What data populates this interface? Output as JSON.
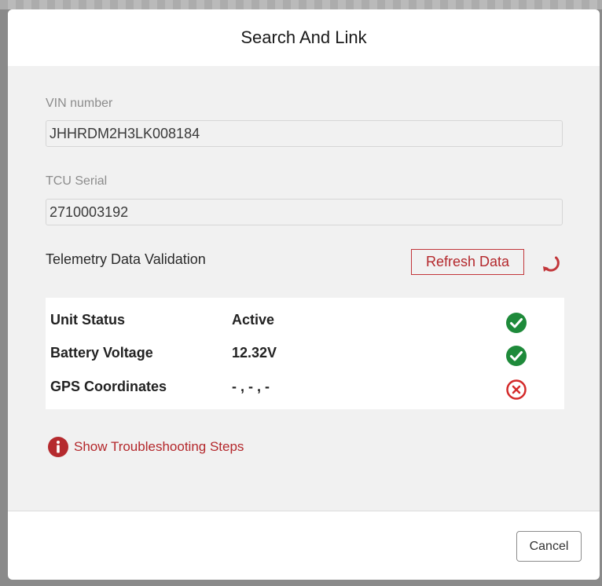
{
  "dialog": {
    "title": "Search And Link",
    "cancel_label": "Cancel"
  },
  "vin": {
    "label": "VIN number",
    "value": "JHHRDM2H3LK008184"
  },
  "tcu": {
    "label": "TCU Serial",
    "value": "2710003192"
  },
  "telemetry": {
    "title": "Telemetry Data Validation",
    "refresh_label": "Refresh Data",
    "rows": [
      {
        "label": "Unit Status",
        "value": "Active",
        "status": "ok",
        "icon": "check-circle-icon"
      },
      {
        "label": "Battery Voltage",
        "value": "12.32V",
        "status": "ok",
        "icon": "check-circle-icon"
      },
      {
        "label": "GPS Coordinates",
        "value": "- , - , -",
        "status": "error",
        "icon": "error-circle-icon"
      }
    ]
  },
  "troubleshooting": {
    "label": "Show Troubleshooting Steps",
    "icon": "info-icon"
  },
  "colors": {
    "accent": "#b4282c",
    "success": "#1e8a3a",
    "error": "#d42a2a",
    "body_background": "#f1f1f1"
  }
}
